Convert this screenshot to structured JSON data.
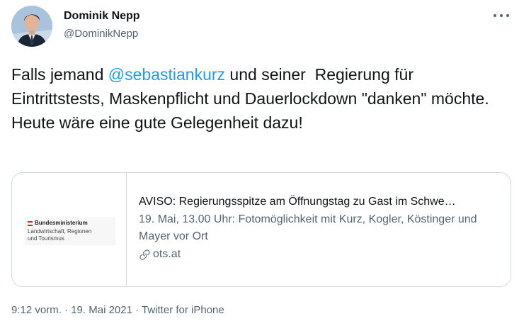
{
  "author": {
    "name": "Dominik Nepp",
    "handle": "@DominikNepp"
  },
  "tweet": {
    "text_before": "Falls jemand ",
    "mention": "@sebastiankurz",
    "text_after": " und seiner  Regierung für Eintrittstests, Maskenpflicht und Dauerlockdown \"danken\" möchte. Heute wäre eine gute Gelegenheit dazu!"
  },
  "card": {
    "logo": {
      "line1": "Bundesministerium",
      "line2": "Landwirtschaft, Regionen",
      "line3": "und Tourismus",
      "flag_colors": [
        "#d6222a",
        "#ffffff",
        "#d6222a"
      ]
    },
    "title": "AVISO: Regierungsspitze am Öffnungstag zu Gast im Schwe…",
    "description": "19. Mai, 13.00 Uhr: Fotomöglichkeit mit Kurz, Kogler, Köstinger und Mayer vor Ort",
    "domain": "ots.at"
  },
  "meta": {
    "time": "9:12 vorm.",
    "separator1": " · ",
    "date": "19. Mai 2021",
    "separator2": " · ",
    "source": "Twitter for iPhone"
  },
  "colors": {
    "accent": "#1d9bf0",
    "text": "#0f1419",
    "secondary": "#536471",
    "border": "#cfd9de"
  }
}
